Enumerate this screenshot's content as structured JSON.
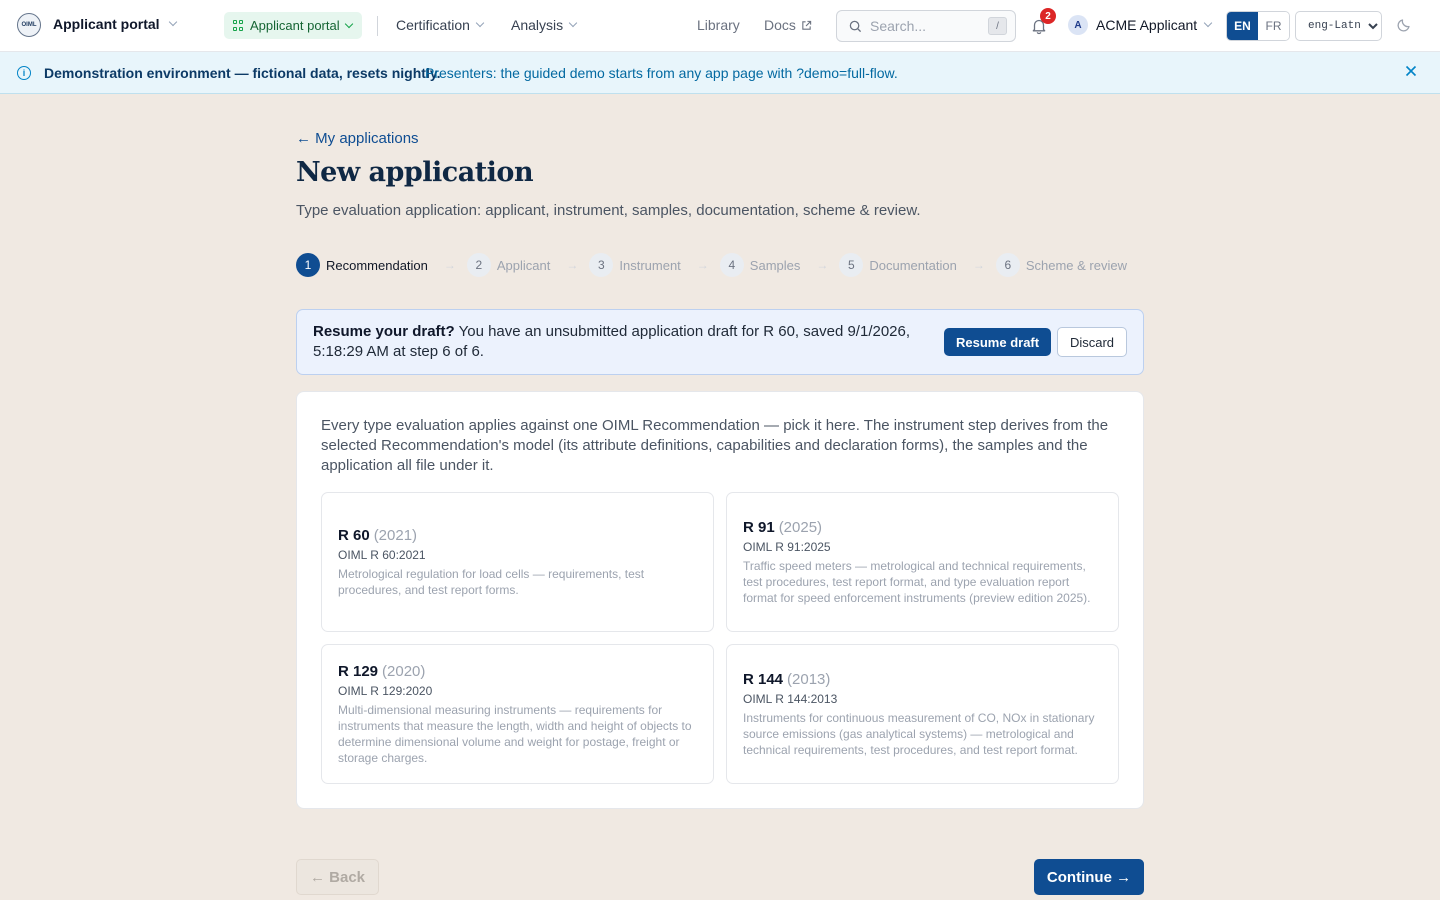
{
  "header": {
    "app_name": "Applicant portal",
    "portal_pill": "Applicant portal",
    "nav": {
      "certification": "Certification",
      "analysis": "Analysis",
      "library": "Library",
      "docs": "Docs"
    },
    "search_placeholder": "Search...",
    "search_shortcut": "/",
    "notifications_count": "2",
    "user_initial": "A",
    "user_name": "ACME Applicant",
    "lang_en": "EN",
    "lang_fr": "FR",
    "script_value": "eng-Latn",
    "script_options": [
      "eng-Latn"
    ]
  },
  "banner": {
    "bold": "Demonstration environment — fictional data, resets nightly.",
    "text": "Presenters: the guided demo starts from any app page with ?demo=full-flow."
  },
  "page": {
    "back_link": "← My applications",
    "title": "New application",
    "subtitle": "Type evaluation application: applicant, instrument, samples, documentation, scheme & review."
  },
  "steps": [
    {
      "num": "1",
      "label": "Recommendation",
      "active": true
    },
    {
      "num": "2",
      "label": "Applicant"
    },
    {
      "num": "3",
      "label": "Instrument"
    },
    {
      "num": "4",
      "label": "Samples"
    },
    {
      "num": "5",
      "label": "Documentation"
    },
    {
      "num": "6",
      "label": "Scheme & review"
    }
  ],
  "draft": {
    "bold": "Resume your draft?",
    "text": " You have an unsubmitted application draft for R 60, saved 9/1/2026, 5:18:29 AM at step 6 of 6.",
    "resume_label": "Resume draft",
    "discard_label": "Discard"
  },
  "card": {
    "intro": "Every type evaluation applies against one OIML Recommendation — pick it here. The instrument step derives from the selected Recommendation's model (its attribute definitions, capabilities and declaration forms), the samples and the application all file under it.",
    "recommendations": [
      {
        "name": "R 60",
        "year": "(2021)",
        "code": "OIML R 60:2021",
        "desc": "Metrological regulation for load cells — requirements, test procedures, and test report forms."
      },
      {
        "name": "R 91",
        "year": "(2025)",
        "code": "OIML R 91:2025",
        "desc": "Traffic speed meters — metrological and technical requirements, test procedures, test report format, and type evaluation report format for speed enforcement instruments (preview edition 2025)."
      },
      {
        "name": "R 129",
        "year": "(2020)",
        "code": "OIML R 129:2020",
        "desc": "Multi-dimensional measuring instruments — requirements for instruments that measure the length, width and height of objects to determine dimensional volume and weight for postage, freight or storage charges."
      },
      {
        "name": "R 144",
        "year": "(2013)",
        "code": "OIML R 144:2013",
        "desc": "Instruments for continuous measurement of CO, NOx in stationary source emissions (gas analytical systems) — metrological and technical requirements, test procedures, and test report format."
      }
    ]
  },
  "footer": {
    "back_label": "← Back",
    "continue_label": "Continue →"
  },
  "colors": {
    "accent": "#0f4d92",
    "background": "#f0e9e2",
    "banner": "#e8f5fb",
    "pill": "#e6f6ee"
  }
}
